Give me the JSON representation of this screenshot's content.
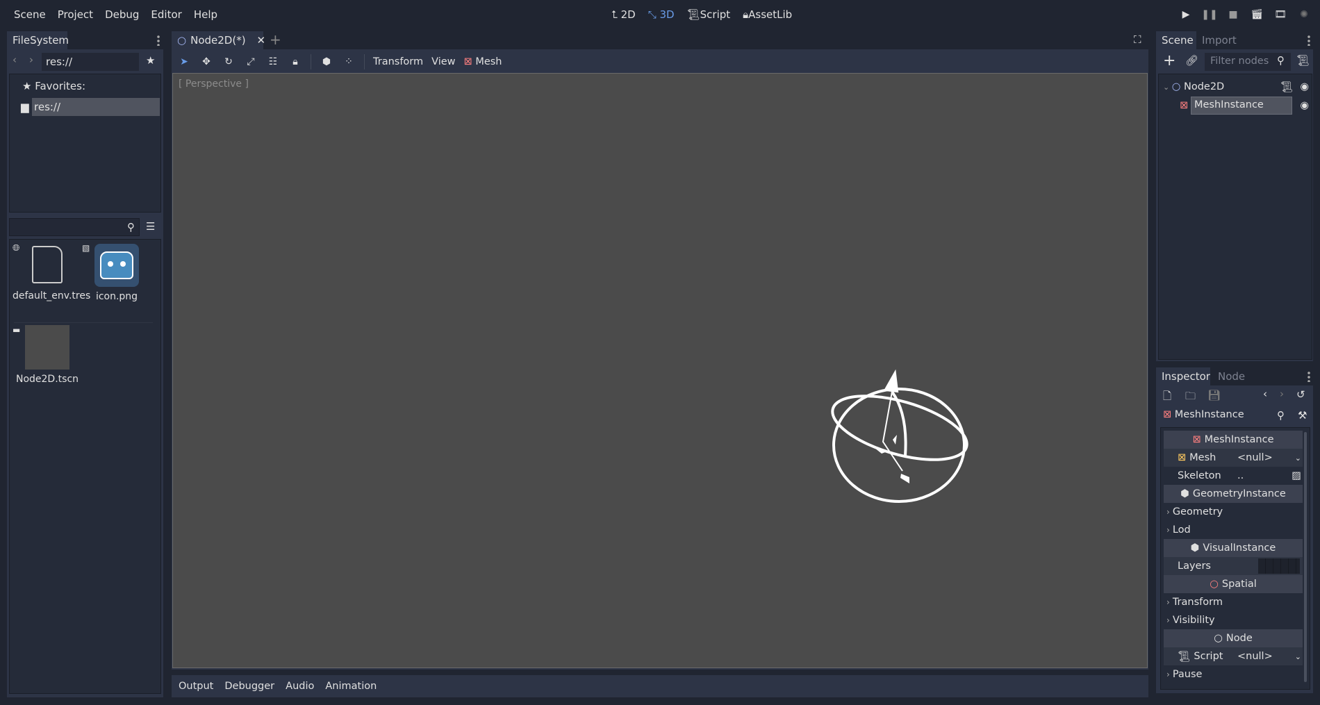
{
  "menu": [
    "Scene",
    "Project",
    "Debug",
    "Editor",
    "Help"
  ],
  "workspaces": [
    {
      "label": "2D",
      "icon": "2d-axes-icon"
    },
    {
      "label": "3D",
      "icon": "3d-axes-icon",
      "active": true
    },
    {
      "label": "Script",
      "icon": "script-icon"
    },
    {
      "label": "AssetLib",
      "icon": "assetlib-icon"
    }
  ],
  "accent": "#699ce8",
  "filesystem": {
    "tab": "FileSystem",
    "path": "res://",
    "favorites_label": "Favorites:",
    "tree_root": "res://",
    "search_placeholder": "",
    "files": [
      {
        "name": "default_env.tres",
        "icon": "globe-icon"
      },
      {
        "name": "icon.png",
        "icon": "image-icon"
      },
      {
        "name": "Node2D.tscn",
        "icon": "clapper-icon"
      }
    ]
  },
  "editor": {
    "scene_tab": "Node2D(*)",
    "toolbar": {
      "transform": "Transform",
      "view": "View",
      "mesh": "Mesh"
    },
    "viewport_label": "[ Perspective ]"
  },
  "bottom_tabs": [
    "Output",
    "Debugger",
    "Audio",
    "Animation"
  ],
  "scene_dock": {
    "tabs": [
      "Scene",
      "Import"
    ],
    "filter_placeholder": "Filter nodes",
    "nodes": [
      {
        "name": "Node2D",
        "type": "node2d"
      },
      {
        "name": "MeshInstance",
        "type": "meshinstance",
        "selected": true
      }
    ]
  },
  "inspector": {
    "tabs": [
      "Inspector",
      "Node"
    ],
    "object": "MeshInstance",
    "rows": [
      {
        "kind": "head",
        "label": "MeshInstance",
        "icon": "meshinstance-icon"
      },
      {
        "kind": "prop",
        "label": "Mesh",
        "value": "<null>",
        "icon": "mesh-icon"
      },
      {
        "kind": "prop",
        "label": "Skeleton",
        "value": ".."
      },
      {
        "kind": "head",
        "label": "GeometryInstance",
        "icon": "cube-icon"
      },
      {
        "kind": "group",
        "label": "Geometry"
      },
      {
        "kind": "group",
        "label": "Lod"
      },
      {
        "kind": "head",
        "label": "VisualInstance",
        "icon": "cube-icon"
      },
      {
        "kind": "prop",
        "label": "Layers",
        "value": ""
      },
      {
        "kind": "head",
        "label": "Spatial",
        "icon": "spatial-circle-icon"
      },
      {
        "kind": "group",
        "label": "Transform"
      },
      {
        "kind": "group",
        "label": "Visibility"
      },
      {
        "kind": "head",
        "label": "Node",
        "icon": "node-circle-icon"
      },
      {
        "kind": "prop",
        "label": "Script",
        "value": "<null>",
        "icon": "script-icon"
      },
      {
        "kind": "group",
        "label": "Pause"
      }
    ]
  }
}
